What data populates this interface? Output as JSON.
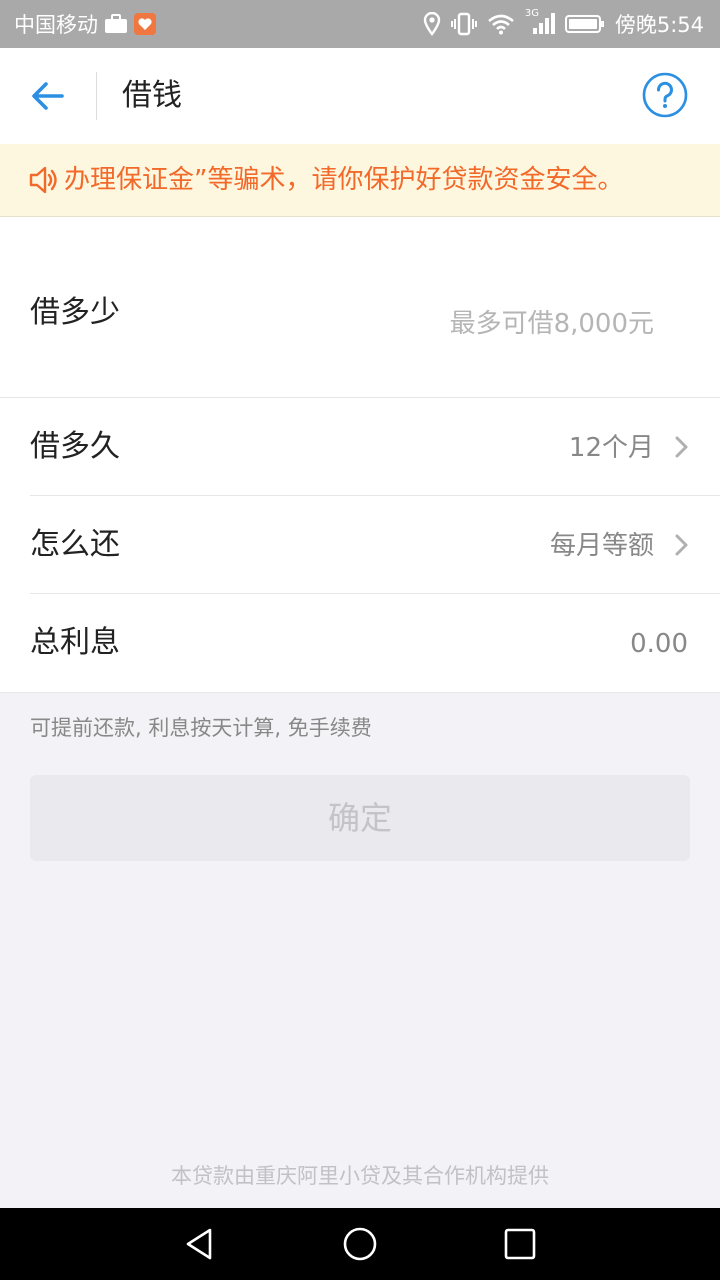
{
  "status_bar": {
    "carrier": "中国移动",
    "network": "3G",
    "time": "傍晚5:54"
  },
  "app_bar": {
    "title": "借钱",
    "back_icon": "back-arrow-icon",
    "help_icon": "help-circle-icon"
  },
  "notice": {
    "icon": "speaker-icon",
    "text": "办理保证金”等骗术，请你保护好贷款资金安全。"
  },
  "form": {
    "amount": {
      "label": "借多少",
      "placeholder": "最多可借8,000元"
    },
    "term": {
      "label": "借多久",
      "value": "12个月"
    },
    "repay": {
      "label": "怎么还",
      "value": "每月等额"
    },
    "interest": {
      "label": "总利息",
      "value": "0.00"
    }
  },
  "hint": "可提前还款, 利息按天计算, 免手续费",
  "confirm_label": "确定",
  "footer": "本贷款由重庆阿里小贷及其合作机构提供",
  "colors": {
    "accent": "#2b8fe2",
    "notice_text": "#f2692a",
    "notice_bg": "#fdf7e0",
    "status_bar": "#a9a9a9"
  }
}
